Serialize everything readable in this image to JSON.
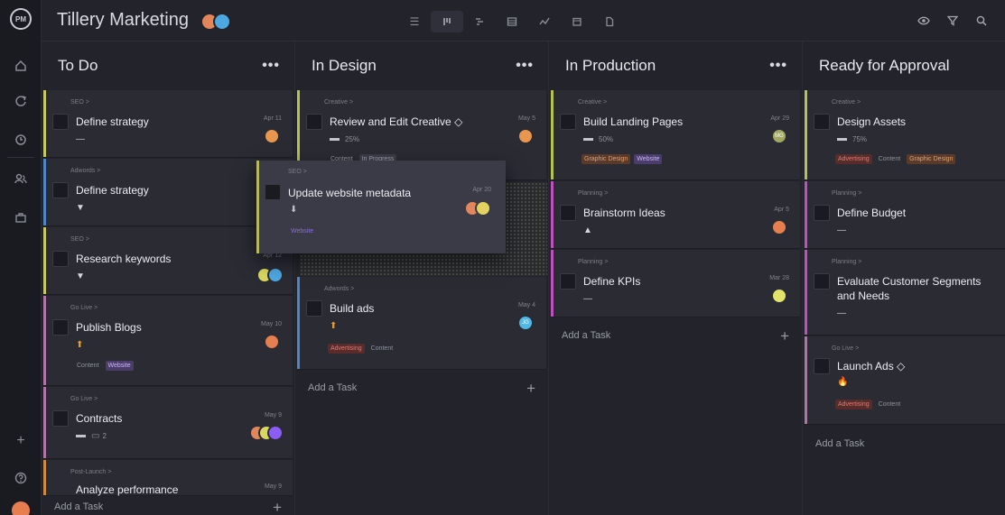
{
  "rail": {
    "logo": "PM",
    "icons": [
      "home-icon",
      "refresh-icon",
      "clock-icon",
      "users-icon",
      "briefcase-icon",
      "plus-icon",
      "help-icon"
    ]
  },
  "topbar": {
    "project": "Tillery Marketing",
    "views": [
      "list-view-icon",
      "board-view-icon",
      "gantt-view-icon",
      "table-view-icon",
      "dashboard-view-icon",
      "calendar-view-icon",
      "files-view-icon"
    ],
    "tools": [
      "eye-icon",
      "filter-icon",
      "search-icon"
    ]
  },
  "columns": [
    {
      "title": "To Do",
      "menu": "•••",
      "add": "Add a Task",
      "add_icon": "+",
      "cards": [
        {
          "crumb": "SEO >",
          "title": "Define strategy",
          "date": "Apr 11",
          "priority": "—"
        },
        {
          "crumb": "Adwords >",
          "title": "Define strategy",
          "date": "",
          "priority": "▼"
        },
        {
          "crumb": "SEO >",
          "title": "Research keywords",
          "date": "Apr 12",
          "priority": "▼"
        },
        {
          "crumb": "Go Live >",
          "title": "Publish Blogs",
          "date": "May 10",
          "priority": "⬆",
          "tags": [
            "Content",
            "Website"
          ]
        },
        {
          "crumb": "Go Live >",
          "title": "Contracts",
          "date": "May 9",
          "priority": "—",
          "comments": "2"
        },
        {
          "crumb": "Post-Launch >",
          "title": "Analyze performance",
          "date": "May 9"
        }
      ]
    },
    {
      "title": "In Design",
      "menu": "•••",
      "add": "Add a Task",
      "add_icon": "+",
      "cards": [
        {
          "crumb": "Creative >",
          "title": "Review and Edit Creative ◇",
          "date": "May 5",
          "progress": "25%",
          "tags": [
            "Content",
            "In Progress"
          ]
        },
        {
          "crumb": "Adwords >",
          "title": "Build ads",
          "date": "May 4",
          "priority": "⬆",
          "tags": [
            "Advertising",
            "Content"
          ],
          "initials": "JG"
        }
      ]
    },
    {
      "title": "In Production",
      "menu": "•••",
      "add": "Add a Task",
      "add_icon": "+",
      "cards": [
        {
          "crumb": "Creative >",
          "title": "Build Landing Pages",
          "date": "Apr 29",
          "progress": "50%",
          "tags": [
            "Graphic Design",
            "Website"
          ],
          "initials": "MG"
        },
        {
          "crumb": "Planning >",
          "title": "Brainstorm Ideas",
          "date": "Apr 5",
          "priority": "▲"
        },
        {
          "crumb": "Planning >",
          "title": "Define KPIs",
          "date": "Mar 28",
          "priority": "—"
        }
      ]
    },
    {
      "title": "Ready for Approval",
      "add": "Add a Task",
      "cards": [
        {
          "crumb": "Creative >",
          "title": "Design Assets",
          "progress": "75%",
          "tags": [
            "Advertising",
            "Content",
            "Graphic Design"
          ]
        },
        {
          "crumb": "Planning >",
          "title": "Define Budget",
          "priority": "—"
        },
        {
          "crumb": "Planning >",
          "title": "Evaluate Customer Segments and Needs",
          "priority": "—"
        },
        {
          "crumb": "Go Live >",
          "title": "Launch Ads ◇",
          "priority": "🔥",
          "tags": [
            "Advertising",
            "Content"
          ]
        }
      ]
    }
  ],
  "dragging": {
    "crumb": "SEO >",
    "title": "Update website metadata",
    "date": "Apr 20",
    "priority": "⬇",
    "tags": [
      "Website"
    ]
  },
  "colors": {
    "seo": "#c7c95c",
    "adwords": "#4c86c9",
    "golive": "#b274a6",
    "postlaunch": "#d08b3a",
    "creative": "#b7c24f",
    "planning": "#c14fc0",
    "purple_tag": "#8b5cf6",
    "red_tag": "#d0453c"
  }
}
